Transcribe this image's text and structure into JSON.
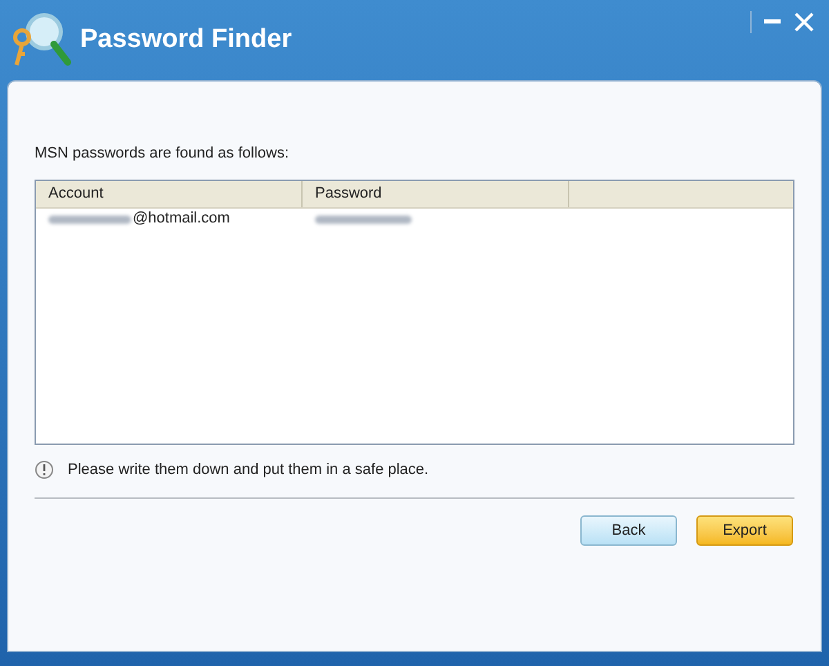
{
  "window": {
    "title": "Password Finder"
  },
  "intro": "MSN passwords are found as follows:",
  "table": {
    "columns": [
      "Account",
      "Password"
    ],
    "rows": [
      {
        "account": "@hotmail.com",
        "account_blurred": true,
        "password_blurred": true
      }
    ]
  },
  "note": "Please write them down and put them in a safe place.",
  "buttons": [
    {
      "label": "Back",
      "kind": "secondary"
    },
    {
      "label": "Export",
      "kind": "primary"
    }
  ]
}
